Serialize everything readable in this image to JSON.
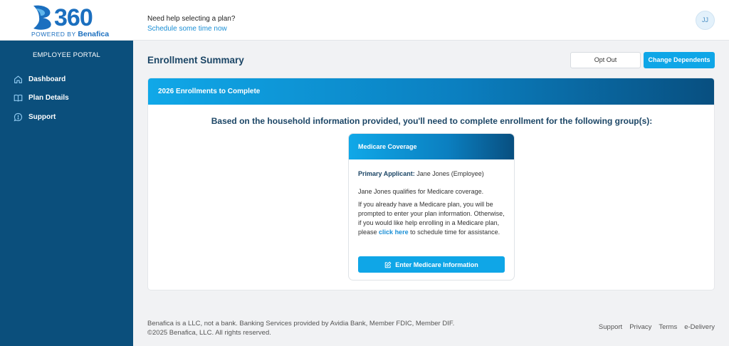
{
  "header": {
    "logo_number": "360",
    "logo_powered": "POWERED BY",
    "logo_brand": "Benafica",
    "help_question": "Need help selecting a plan?",
    "help_link": "Schedule some time now",
    "avatar_initials": "JJ"
  },
  "sidebar": {
    "portal_label": "EMPLOYEE PORTAL",
    "items": [
      {
        "label": "Dashboard",
        "icon": "home-icon"
      },
      {
        "label": "Plan Details",
        "icon": "book-icon"
      },
      {
        "label": "Support",
        "icon": "help-circle-icon"
      }
    ]
  },
  "main": {
    "title": "Enrollment Summary",
    "opt_out_label": "Opt Out",
    "change_dependents_label": "Change Dependents",
    "card": {
      "header": "2026 Enrollments to Complete",
      "intro": "Based on the household information provided, you'll need to complete enrollment for the following group(s):",
      "group": {
        "header": "Medicare Coverage",
        "primary_label": "Primary Applicant:",
        "primary_value": "Jane Jones (Employee)",
        "qualify_text": "Jane Jones qualifies for Medicare coverage.",
        "para_before_link": "If you already have a Medicare plan, you will be prompted to enter your plan information. Otherwise, if you would like help enrolling in a Medicare plan, please",
        "link_text": "click here",
        "para_after_link": "to schedule time for assistance.",
        "button_label": "Enter Medicare Information",
        "button_icon": "edit-icon"
      }
    }
  },
  "footer": {
    "line1": "Benafica is a LLC, not a bank. Banking Services provided by Avidia Bank, Member FDIC, Member DIF.",
    "line2": "©2025 Benafica, LLC. All rights reserved.",
    "links": [
      "Support",
      "Privacy",
      "Terms",
      "e-Delivery"
    ]
  },
  "colors": {
    "sidebar": "#0b4f7c",
    "accent": "#0fa6e7",
    "heading": "#1c4666"
  }
}
